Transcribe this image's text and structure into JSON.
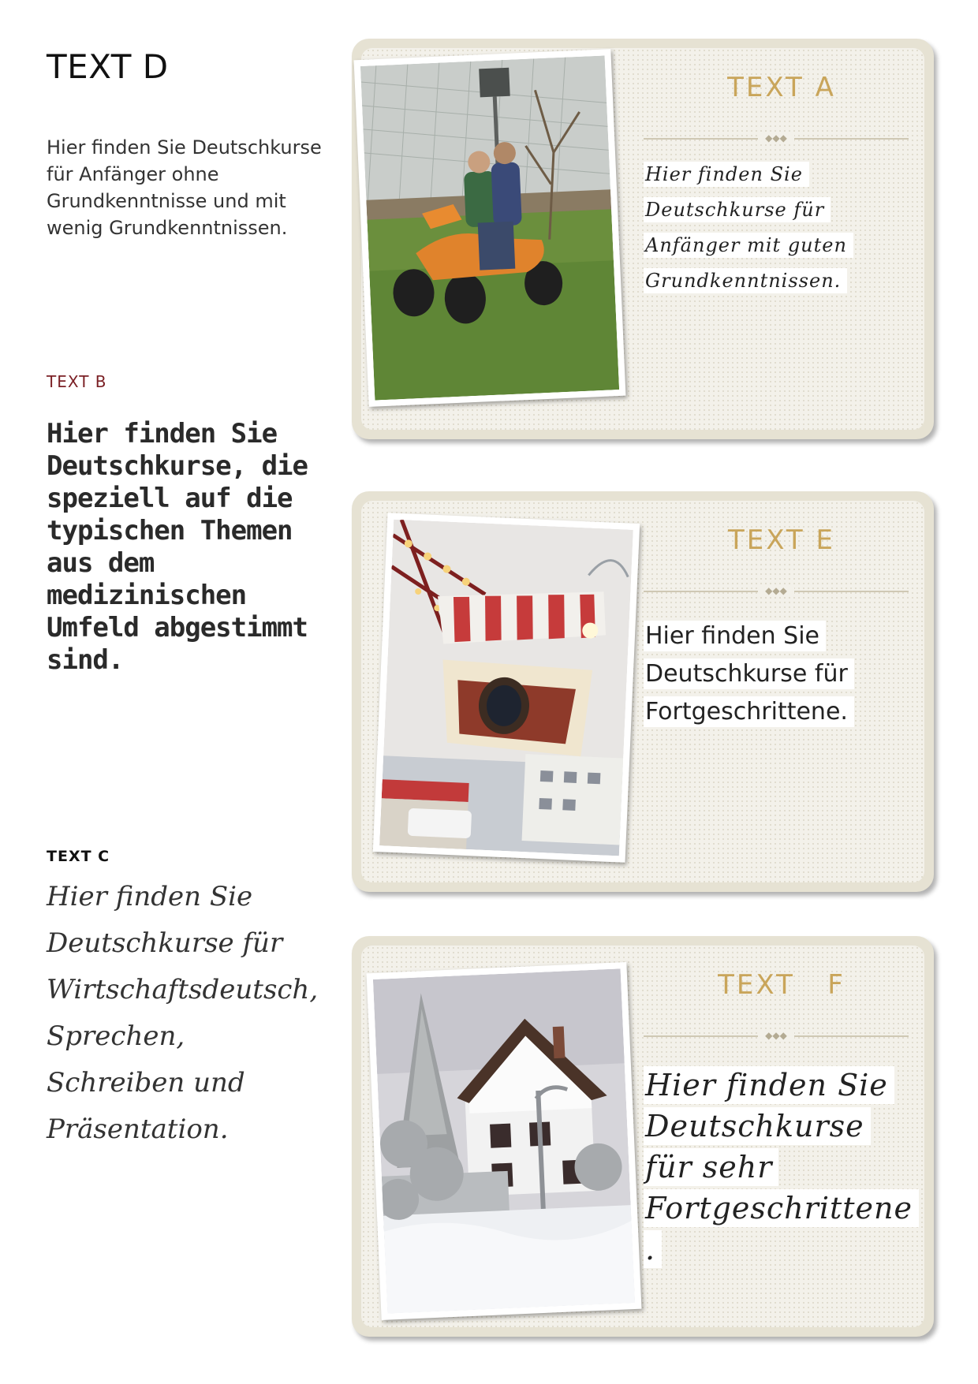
{
  "left": {
    "text_d": {
      "title": "TEXT D",
      "body": "Hier finden Sie Deutschkurse für Anfänger ohne Grundkenntnisse und mit wenig Grundkenntnissen."
    },
    "text_b": {
      "label": "TEXT B",
      "body": "Hier finden Sie Deutschkurse, die speziell auf die typischen Themen aus dem medizinischen Umfeld abgestimmt sind."
    },
    "text_c": {
      "label": "TEXT C",
      "body": "Hier finden Sie Deutschkurse für Wirtschaftsdeutsch, Sprechen, Schreiben und Präsentation."
    }
  },
  "cards": {
    "a": {
      "title": "TEXT A",
      "body": "Hier finden Sie Deutschkurse für Anfänger mit guten Grundkenntnissen.",
      "photo_icon": "quad-bike-photo"
    },
    "e": {
      "title": "TEXT E",
      "body": "Hier finden Sie Deutschkurse für Fortgeschrittene.",
      "photo_icon": "ferris-wheel-photo"
    },
    "f": {
      "title": "TEXT   F",
      "body": "Hier finden Sie Deutschkurse für sehr Fortgeschrittene .",
      "photo_icon": "snowy-house-photo"
    }
  },
  "colors": {
    "card_title": "#c9a55a",
    "label_b": "#7a1f24",
    "card_frame": "#e6e2d3",
    "card_fill": "#f3f1ea"
  }
}
